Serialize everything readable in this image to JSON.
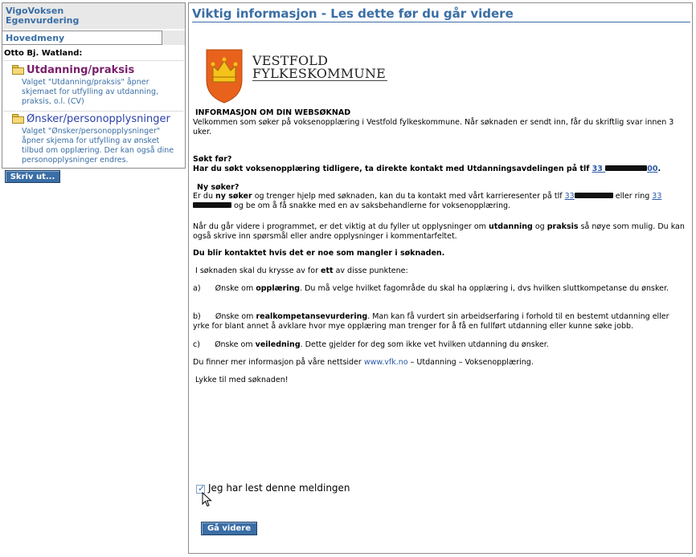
{
  "sidebar": {
    "app_title_line1": "VigoVoksen",
    "app_title_line2": "Egenvurdering",
    "menu_tab": "Hovedmeny",
    "user": "Otto Bj. Watland:",
    "items": [
      {
        "label": "Utdanning/praksis",
        "icon": "folder-icon",
        "color": "#7a1f6b",
        "desc": "Valget \"Utdanning/praksis\" åpner skjemaet for utfylling av utdanning, praksis, o.l. (CV)"
      },
      {
        "label": "Ønsker/personopplysninger",
        "icon": "folder-icon",
        "color": "#2a3faa",
        "desc": "Valget \"Ønsker/personopplysninger\" åpner skjema for utfylling av ønsket tilbud om opplæring. Der kan også dine personopplysninger endres."
      }
    ],
    "print_button": "Skriv ut..."
  },
  "main": {
    "title": "Viktig informasjon - Les dette før du går videre",
    "logo": {
      "line1": "VESTFOLD",
      "line2": "FYLKESKOMMUNE"
    },
    "heading": "INFORMASJON OM DIN WEBSØKNAD",
    "intro": "Velkommen som søker på voksenopplæring i Vestfold fylkeskommune. Når søknaden er sendt inn, får du skriftlig svar innen 3 uker.",
    "sokt_heading": "Søkt før?",
    "sokt_text": "Har du søkt voksenopplæring tidligere, ta direkte kontakt med Utdanningsavdelingen på tlf",
    "sokt_phone_prefix": "33",
    "sokt_phone_suffix": "00",
    "ny_heading": "Ny søker?",
    "ny_text_a": "Er du",
    "ny_text_bold": "ny søker",
    "ny_text_b": "og trenger hjelp med søknaden, kan du ta kontakt med vårt karrieresenter på tlf",
    "ny_phone1": "33",
    "ny_text_c": "eller ring",
    "ny_phone2": "33",
    "ny_text_d": "og be om å få snakke med en av saksbehandlerne for voksenopplæring.",
    "p1_a": "Når du går videre i programmet, er det viktig at du fyller ut opplysninger om",
    "p1_bold1": "utdanning",
    "p1_and": "og",
    "p1_bold2": "praksis",
    "p1_b": "så nøye som mulig. Du kan også skrive inn spørsmål eller andre opplysninger i kommentarfeltet.",
    "contact_bold": "Du blir kontaktet hvis det er noe som mangler i søknaden.",
    "choose_a": "I søknaden skal du krysse av for",
    "choose_bold": "ett",
    "choose_b": "av disse punktene:",
    "opt_a_label": "a)",
    "opt_a_pre": "Ønske om",
    "opt_a_bold": "opplæring",
    "opt_a_text": ". Du må velge hvilket fagområde du skal ha opplæring i, dvs hvilken sluttkompetanse du ønsker.",
    "opt_b_label": "b)",
    "opt_b_pre": "Ønske om",
    "opt_b_bold": "realkompetansevurdering",
    "opt_b_text": ". Man kan få vurdert sin arbeidserfaring i forhold til en bestemt utdanning eller yrke for blant annet å avklare hvor mye opplæring man trenger for å få en fullført utdanning eller kunne søke jobb.",
    "opt_c_label": "c)",
    "opt_c_pre": "Ønske om",
    "opt_c_bold": "veiledning",
    "opt_c_text": ". Dette gjelder for deg som ikke vet hvilken utdanning du ønsker.",
    "more_a": "Du finner mer informasjon på våre nettsider",
    "more_link": "www.vfk.no",
    "more_b": "– Utdanning – Voksenopplæring.",
    "luck": "Lykke til med søknaden!",
    "checkbox_label": "Jeg har lest denne meldingen",
    "checkbox_checked": true,
    "continue_button": "Gå videre"
  },
  "colors": {
    "accent": "#3a6ea5",
    "button": "#3a6ea5",
    "link": "#2a58a8"
  }
}
